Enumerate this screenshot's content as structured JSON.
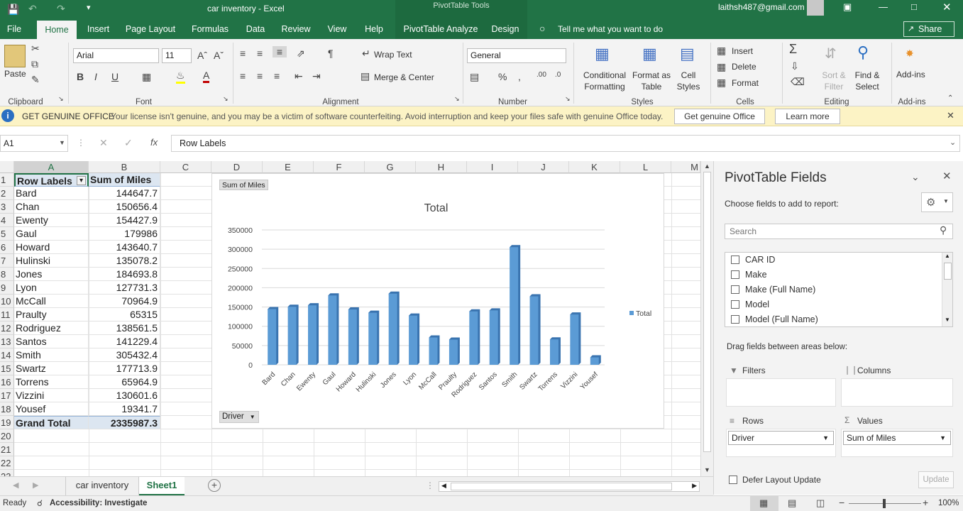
{
  "window": {
    "title": "car inventory  -  Excel",
    "context_title": "PivotTable Tools",
    "user": "laithsh487@gmail.com"
  },
  "tabs": [
    "File",
    "Home",
    "Insert",
    "Page Layout",
    "Formulas",
    "Data",
    "Review",
    "View",
    "Help",
    "PivotTable Analyze",
    "Design"
  ],
  "tell_me": "Tell me what you want to do",
  "share": "Share",
  "ribbon": {
    "clipboard": {
      "paste": "Paste",
      "group": "Clipboard"
    },
    "font": {
      "name": "Arial",
      "size": "11",
      "group": "Font"
    },
    "alignment": {
      "wrap": "Wrap Text",
      "merge": "Merge & Center",
      "group": "Alignment"
    },
    "number": {
      "format": "General",
      "group": "Number"
    },
    "styles": {
      "conditional": "Conditional",
      "formatting": "Formatting",
      "format_as": "Format as",
      "table": "Table",
      "cell": "Cell",
      "styles_btn": "Styles",
      "group": "Styles"
    },
    "cells": {
      "insert": "Insert",
      "delete": "Delete",
      "format": "Format",
      "group": "Cells"
    },
    "editing": {
      "sort": "Sort &",
      "filter": "Filter",
      "find": "Find &",
      "select": "Select",
      "group": "Editing"
    },
    "addins": {
      "label": "Add-ins",
      "group": "Add-ins"
    }
  },
  "message_bar": {
    "title": "GET GENUINE OFFICE",
    "text": "Your license isn't genuine, and you may be a victim of software counterfeiting. Avoid interruption and keep your files safe with genuine Office today.",
    "btn1": "Get genuine Office",
    "btn2": "Learn more"
  },
  "formula": {
    "name_box": "A1",
    "content": "Row Labels"
  },
  "columns": [
    "A",
    "B",
    "C",
    "D",
    "E",
    "F",
    "G",
    "H",
    "I",
    "J",
    "K",
    "L",
    "M"
  ],
  "pivot": {
    "header_a": "Row Labels",
    "header_b": "Sum of Miles",
    "rows": [
      {
        "label": "Bard",
        "value": "144647.7"
      },
      {
        "label": "Chan",
        "value": "150656.4"
      },
      {
        "label": "Ewenty",
        "value": "154427.9"
      },
      {
        "label": "Gaul",
        "value": "179986"
      },
      {
        "label": "Howard",
        "value": "143640.7"
      },
      {
        "label": "Hulinski",
        "value": "135078.2"
      },
      {
        "label": "Jones",
        "value": "184693.8"
      },
      {
        "label": "Lyon",
        "value": "127731.3"
      },
      {
        "label": "McCall",
        "value": "70964.9"
      },
      {
        "label": "Praulty",
        "value": "65315"
      },
      {
        "label": "Rodriguez",
        "value": "138561.5"
      },
      {
        "label": "Santos",
        "value": "141229.4"
      },
      {
        "label": "Smith",
        "value": "305432.4"
      },
      {
        "label": "Swartz",
        "value": "177713.9"
      },
      {
        "label": "Torrens",
        "value": "65964.9"
      },
      {
        "label": "Vizzini",
        "value": "130601.6"
      },
      {
        "label": "Yousef",
        "value": "19341.7"
      }
    ],
    "total_label": "Grand Total",
    "total_value": "2335987.3"
  },
  "chart_data": {
    "type": "bar",
    "title": "Total",
    "field_button": "Sum of Miles",
    "axis_button": "Driver",
    "categories": [
      "Bard",
      "Chan",
      "Ewenty",
      "Gaul",
      "Howard",
      "Hulinski",
      "Jones",
      "Lyon",
      "McCall",
      "Praulty",
      "Rodriguez",
      "Santos",
      "Smith",
      "Swartz",
      "Torrens",
      "Vizzini",
      "Yousef"
    ],
    "series": [
      {
        "name": "Total",
        "color": "#5b9bd5",
        "values": [
          144647.7,
          150656.4,
          154427.9,
          179986,
          143640.7,
          135078.2,
          184693.8,
          127731.3,
          70964.9,
          65315,
          138561.5,
          141229.4,
          305432.4,
          177713.9,
          65964.9,
          130601.6,
          19341.7
        ]
      }
    ],
    "yticks": [
      "0",
      "50000",
      "100000",
      "150000",
      "200000",
      "250000",
      "300000",
      "350000"
    ],
    "ylim": [
      0,
      350000
    ],
    "grid": true,
    "legend": "right"
  },
  "sheets": [
    "car inventory",
    "Sheet1"
  ],
  "active_sheet": "Sheet1",
  "pane": {
    "title": "PivotTable Fields",
    "subtitle": "Choose fields to add to report:",
    "search_placeholder": "Search",
    "fields": [
      "CAR ID",
      "Make",
      "Make (Full Name)",
      "Model",
      "Model (Full Name)"
    ],
    "drag_label": "Drag fields between areas below:",
    "filters": "Filters",
    "columns": "Columns",
    "rows": "Rows",
    "values": "Values",
    "rows_field": "Driver",
    "values_field": "Sum of Miles",
    "defer": "Defer Layout Update",
    "update": "Update"
  },
  "status": {
    "ready": "Ready",
    "accessibility": "Accessibility: Investigate",
    "zoom": "100%"
  }
}
